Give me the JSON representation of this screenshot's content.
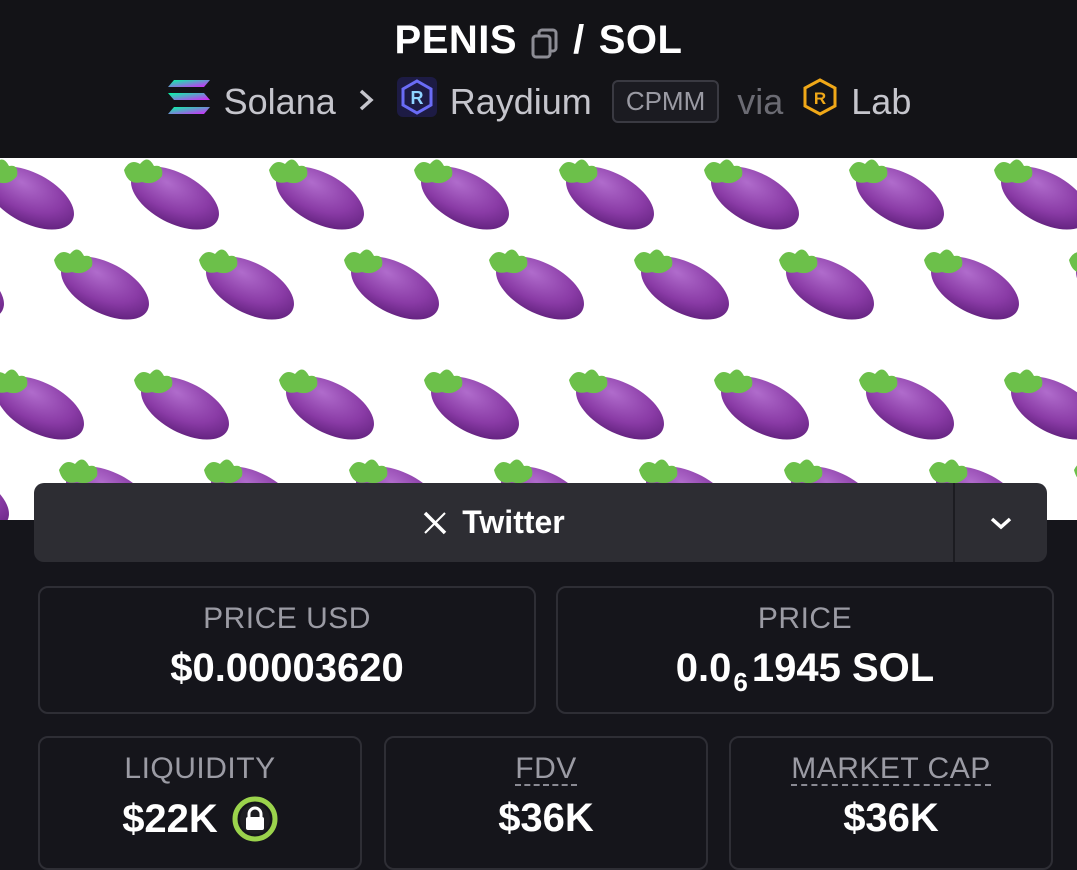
{
  "header": {
    "token_symbol": "PENIS",
    "quote_symbol": "SOL",
    "slash": "/",
    "chain": "Solana",
    "dex": "Raydium",
    "pool_type": "CPMM",
    "via_label": "via",
    "launchpad": "Lab",
    "icons": [
      "copy-icon",
      "solana-logo",
      "chevron-right-icon",
      "raydium-logo",
      "raydium-lab-logo"
    ]
  },
  "banner": {
    "description": "eggplant emoji pattern",
    "colors": {
      "background": "#ffffff",
      "eggplant": "#8e3fa6",
      "leaf": "#6cc04a"
    }
  },
  "social": {
    "twitter_label": "Twitter",
    "icons": [
      "x-logo-icon",
      "chevron-down-icon"
    ]
  },
  "stats": {
    "price_usd_label": "PRICE USD",
    "price_usd_value": "$0.00003620",
    "price_label": "PRICE",
    "price_prefix": "0.0",
    "price_zero_count": "6",
    "price_digits": "1945 SOL",
    "liquidity_label": "LIQUIDITY",
    "liquidity_value": "$22K",
    "fdv_label": "FDV",
    "fdv_value": "$36K",
    "market_cap_label": "MARKET CAP",
    "market_cap_value": "$36K"
  },
  "colors": {
    "page_bg": "#15151b",
    "card_border": "#2e2e35",
    "lock_green": "#9bd34c",
    "label_gray": "#9b9ba4"
  }
}
